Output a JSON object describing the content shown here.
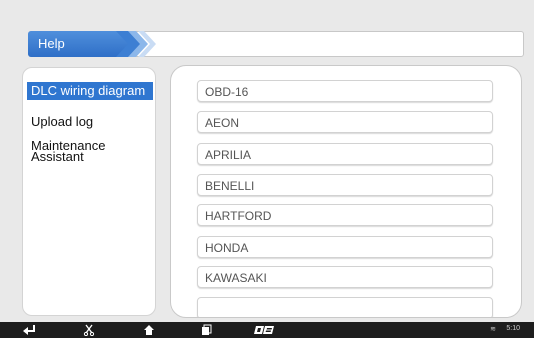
{
  "header": {
    "title": "Help"
  },
  "sidebar": {
    "items": [
      {
        "label": "DLC wiring diagram",
        "active": true
      },
      {
        "label": "Upload log",
        "active": false
      },
      {
        "label": "Maintenance Assistant",
        "active": false
      }
    ]
  },
  "brands": {
    "items": [
      "OBD-16",
      "AEON",
      "APRILIA",
      "BENELLI",
      "HARTFORD",
      "HONDA",
      "KAWASAKI"
    ]
  },
  "navbar": {
    "time": "5:10",
    "icons": [
      "back-icon",
      "scissors-icon",
      "home-icon",
      "recent-apps-icon",
      "logo-icon",
      "wifi-icon"
    ]
  },
  "colors": {
    "accent": "#2f76d0",
    "background": "#e9e9e9",
    "navbar": "#1d1d1d"
  }
}
